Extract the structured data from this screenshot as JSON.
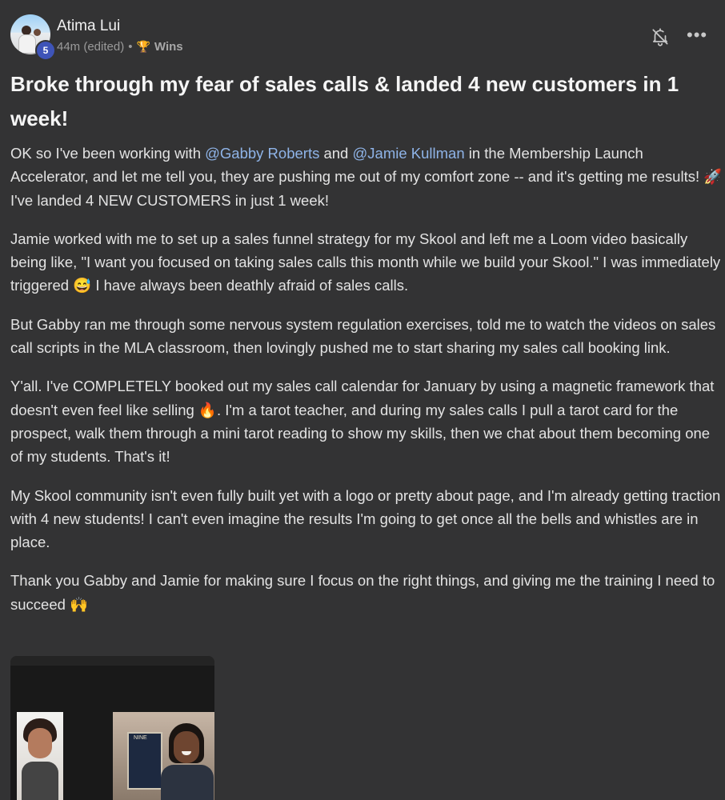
{
  "post": {
    "author": {
      "name": "Atima Lui",
      "level": "5"
    },
    "meta": {
      "time": "44m (edited)",
      "separator": "•",
      "category_icon": "trophy-icon",
      "category": "Wins"
    },
    "actions": {
      "bell_icon": "bell-off-icon",
      "more_icon": "more-icon",
      "more_label": "•••"
    },
    "title": "Broke through my fear of sales calls & landed 4 new customers in 1 week!",
    "paragraphs": {
      "p1": {
        "t1": "OK so I've been working with ",
        "m1": "@Gabby Roberts",
        "t2": " and ",
        "m2": "@Jamie Kullman",
        "t3": " in the Membership Launch Accelerator, and let me tell you, they are pushing me out of my comfort zone -- and it's getting me results! 🚀 I've landed 4 NEW CUSTOMERS in just 1 week!"
      },
      "p2": "Jamie worked with me to set up a sales funnel strategy for my Skool and left me a Loom video basically being like, \"I want you focused on taking sales calls this month while we build your Skool.\" I was immediately triggered 😅 I have always been deathly afraid of sales calls.",
      "p3": "But Gabby ran me through some nervous system regulation exercises, told me to watch the videos on sales call scripts in the MLA classroom, then lovingly pushed me to start sharing my sales call booking link.",
      "p4": "Y'all. I've COMPLETELY booked out my sales call calendar for January by using a magnetic framework that doesn't even feel like selling 🔥. I'm a tarot teacher, and during my sales calls I pull a tarot card for the prospect, walk them through a mini tarot reading to show my skills, then we chat about them becoming one of my students. That's it!",
      "p5": "My Skool community isn't even fully built yet with a logo or pretty about page, and I'm already getting traction with 4 new students! I can't even imagine the results I'm going to get once all the bells and whistles are in place.",
      "p6": "Thank you Gabby and Jamie for making sure I focus on the right things, and giving me the training I need to succeed 🙌"
    },
    "video": {
      "card_text": "NINE"
    }
  },
  "colors": {
    "background": "#333334",
    "mention": "#8fb4e8",
    "level_badge": "#3e54b8",
    "text": "#e3e3e3",
    "meta": "#9a9a9a"
  }
}
